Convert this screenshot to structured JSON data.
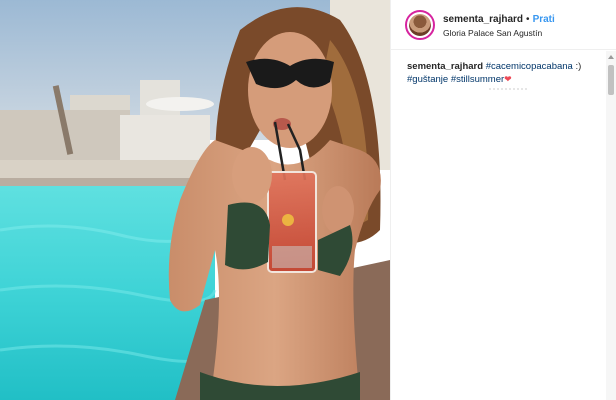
{
  "post": {
    "username": "sementa_rajhard",
    "separator": "•",
    "follow_label": "Prati",
    "location": "Gloria Palace San Agustín"
  },
  "caption": {
    "username": "sementa_rajhard",
    "line1_tag": "#cacemicopacabana",
    "line1_suffix": " :)",
    "line2_tag1": "#guštanje",
    "line2_tag2": "#stillsummer",
    "heart_glyph": "❤"
  },
  "colors": {
    "follow_blue": "#3897f0",
    "hashtag_blue": "#003569",
    "heart_red": "#ed4956",
    "pool_turquoise": "#3ed3d6"
  }
}
